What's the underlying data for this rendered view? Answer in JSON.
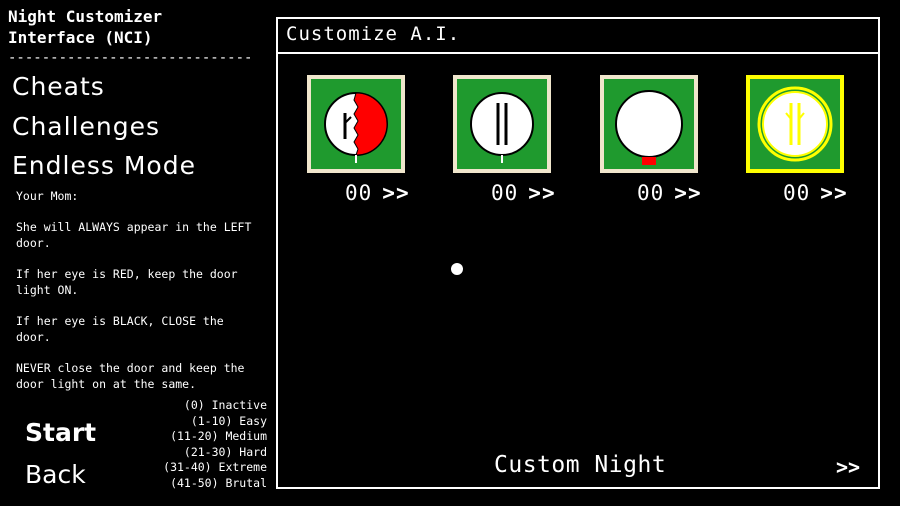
{
  "app": {
    "title": "Night Customizer\nInterface (NCI)",
    "divider": "-----------------------------"
  },
  "menu": {
    "cheats": "Cheats",
    "challenges": "Challenges",
    "endless": "Endless Mode"
  },
  "info": {
    "heading": "Your Mom:",
    "lines": [
      "She will ALWAYS appear in the LEFT door.",
      "If her eye is RED, keep the door light ON.",
      "If her eye is BLACK, CLOSE the door.",
      "NEVER close the door and keep the door light on at the same."
    ]
  },
  "legend": [
    "(0) Inactive",
    "(1-10) Easy",
    "(11-20) Medium",
    "(21-30) Hard",
    "(31-40) Extreme",
    "(41-50) Brutal"
  ],
  "buttons": {
    "start": "Start",
    "back": "Back"
  },
  "panel": {
    "title": "Customize A.I.",
    "custom_night": "Custom Night",
    "next_arrow": ">>"
  },
  "characters": [
    {
      "icon": "half-red-face-icon",
      "value": "00",
      "arrow": ">>",
      "selected": false
    },
    {
      "icon": "double-line-face-icon",
      "value": "00",
      "arrow": ">>",
      "selected": false
    },
    {
      "icon": "blank-face-icon",
      "value": "00",
      "arrow": ">>",
      "selected": false
    },
    {
      "icon": "yellow-branch-face-icon",
      "value": "00",
      "arrow": ">>",
      "selected": true
    }
  ],
  "colors": {
    "portrait_bg": "#1f9a2e",
    "portrait_border": "#f0e6cc",
    "selected_border": "#ffff00",
    "eye_red": "#ff0000"
  }
}
